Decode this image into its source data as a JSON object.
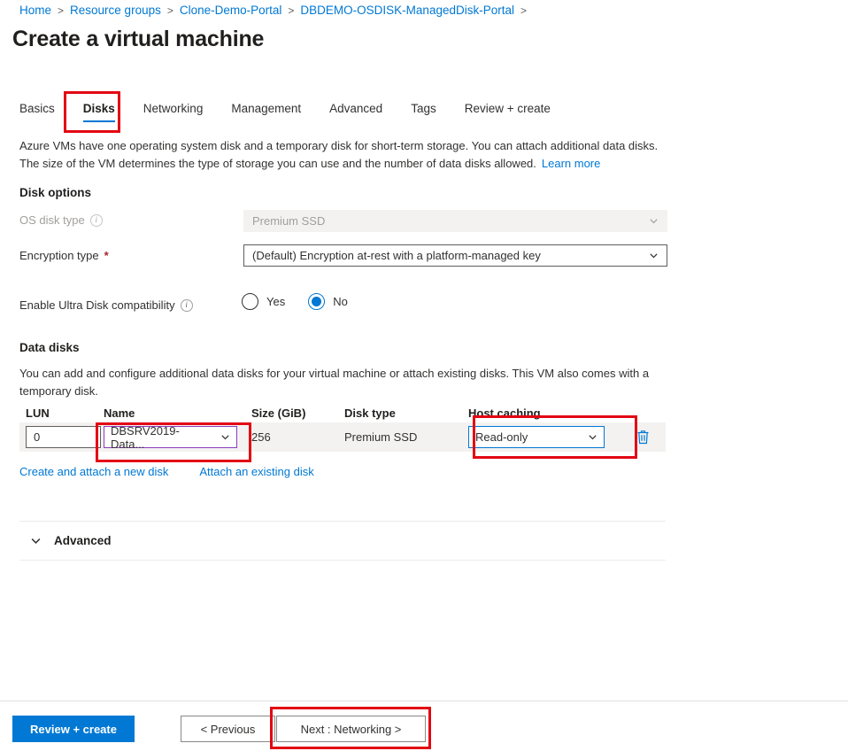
{
  "breadcrumb": {
    "items": [
      {
        "label": "Home"
      },
      {
        "label": "Resource groups"
      },
      {
        "label": "Clone-Demo-Portal"
      },
      {
        "label": "DBDEMO-OSDISK-ManagedDisk-Portal"
      }
    ],
    "separator": ">"
  },
  "page": {
    "title": "Create a virtual machine"
  },
  "tabs": [
    {
      "label": "Basics",
      "active": false
    },
    {
      "label": "Disks",
      "active": true
    },
    {
      "label": "Networking",
      "active": false
    },
    {
      "label": "Management",
      "active": false
    },
    {
      "label": "Advanced",
      "active": false
    },
    {
      "label": "Tags",
      "active": false
    },
    {
      "label": "Review + create",
      "active": false
    }
  ],
  "description": {
    "text": "Azure VMs have one operating system disk and a temporary disk for short-term storage. You can attach additional data disks. The size of the VM determines the type of storage you can use and the number of data disks allowed.",
    "learn_more": "Learn more"
  },
  "disk_options": {
    "heading": "Disk options",
    "os_disk_type": {
      "label": "OS disk type",
      "value": "Premium SSD",
      "disabled": true
    },
    "encryption_type": {
      "label": "Encryption type",
      "required_marker": "*",
      "value": "(Default) Encryption at-rest with a platform-managed key"
    },
    "ultra_disk": {
      "label": "Enable Ultra Disk compatibility",
      "options": [
        {
          "label": "Yes",
          "selected": false
        },
        {
          "label": "No",
          "selected": true
        }
      ]
    }
  },
  "data_disks": {
    "heading": "Data disks",
    "description": "You can add and configure additional data disks for your virtual machine or attach existing disks. This VM also comes with a temporary disk.",
    "columns": {
      "lun": "LUN",
      "name": "Name",
      "size": "Size (GiB)",
      "disk_type": "Disk type",
      "host_caching": "Host caching"
    },
    "rows": [
      {
        "lun": "0",
        "name": "DBSRV2019-Data...",
        "size": "256",
        "disk_type": "Premium SSD",
        "host_caching": "Read-only"
      }
    ],
    "links": [
      {
        "label": "Create and attach a new disk"
      },
      {
        "label": "Attach an existing disk"
      }
    ]
  },
  "advanced_section": {
    "label": "Advanced"
  },
  "footer": {
    "review_create": "Review + create",
    "previous": "< Previous",
    "next": "Next : Networking >"
  },
  "colors": {
    "accent": "#0078d4",
    "annotation": "#e30613",
    "name_focus": "#8e3bbd",
    "required": "#a4262c"
  }
}
